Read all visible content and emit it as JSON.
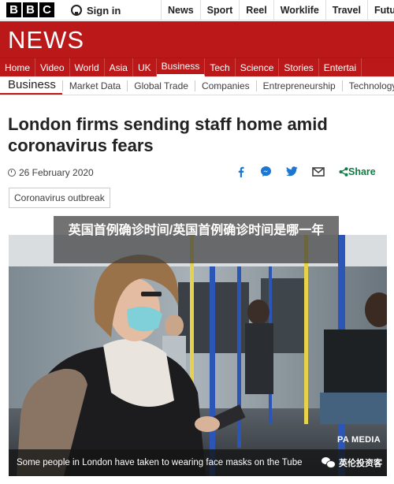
{
  "brand": {
    "logo_letters": [
      "B",
      "B",
      "C"
    ],
    "news_wordmark": "NEWS"
  },
  "topbar": {
    "signin_label": "Sign in",
    "nav": [
      "News",
      "Sport",
      "Reel",
      "Worklife",
      "Travel",
      "Futu"
    ]
  },
  "section_nav": {
    "items": [
      "Home",
      "Video",
      "World",
      "Asia",
      "UK",
      "Business",
      "Tech",
      "Science",
      "Stories",
      "Entertai"
    ],
    "active": "Business"
  },
  "sub_nav": {
    "section": "Business",
    "items": [
      "Market Data",
      "Global Trade",
      "Companies",
      "Entrepreneurship",
      "Technology"
    ]
  },
  "article": {
    "headline": "London firms sending staff home amid coronavirus fears",
    "date": "26 February 2020",
    "share_label": "Share",
    "share_icons": [
      "facebook-icon",
      "messenger-icon",
      "twitter-icon",
      "email-icon",
      "share-icon"
    ],
    "tag": "Coronavirus outbreak",
    "image": {
      "credit": "PA MEDIA",
      "caption": "Some people in London have taken to wearing face masks on the Tube"
    }
  },
  "overlay": {
    "text": "英国首例确诊时间/英国首例确诊时间是哪一年"
  },
  "watermark": {
    "text": "英伦投资客"
  },
  "colors": {
    "bbc_red": "#bb1919",
    "link_blue": "#1b77d1",
    "share_green": "#117b44"
  }
}
